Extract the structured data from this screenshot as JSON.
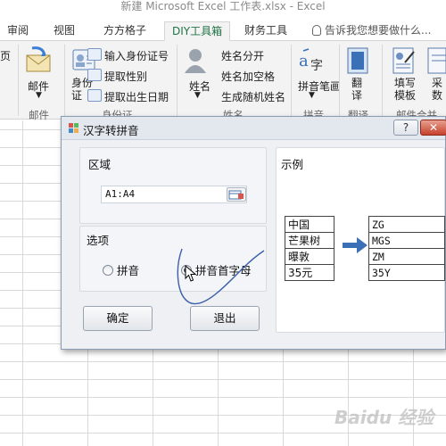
{
  "window": {
    "title": "新建 Microsoft Excel 工作表.xlsx - Excel"
  },
  "ribbon_tabs": [
    {
      "label": "审阅"
    },
    {
      "label": "视图"
    },
    {
      "label": "方方格子"
    },
    {
      "label": "DIY工具箱",
      "active": true
    },
    {
      "label": "财务工具"
    }
  ],
  "tell_me": "告诉我您想要做什么...",
  "ribbon": {
    "left_cut_label": "页",
    "mail_button": "邮件",
    "mail_group": "邮件",
    "id_button": "身份\n证",
    "id_items": [
      "输入身份证号",
      "提取性别",
      "提取出生日期"
    ],
    "id_group": "身份证",
    "name_button": "姓名",
    "name_items": [
      "姓名分开",
      "姓名加空格",
      "生成随机姓名"
    ],
    "name_group": "姓名",
    "pinyin_button": "拼音笔画",
    "pinyin_group": "拼音",
    "translate_button": "翻译",
    "translate_group": "翻译",
    "template_button": "填写模板",
    "template_group": "邮件合并",
    "collect_button": "采数"
  },
  "dialog": {
    "title": "汉字转拼音",
    "help_label": "?",
    "close_label": "✕",
    "range_label": "区域",
    "range_value": "A1:A4",
    "options_label": "选项",
    "option_pinyin": "拼音",
    "option_initials": "拼音首字母",
    "selected_option": "拼音首字母",
    "ok_button": "确定",
    "exit_button": "退出",
    "example_label": "示例",
    "example_input": [
      "中国",
      "芒果树",
      "曝敦",
      "35元"
    ],
    "example_output": [
      "ZG",
      "MGS",
      "ZM",
      "35Y"
    ]
  },
  "colors": {
    "excel_green": "#217346",
    "arrow_blue": "#3b6fb6",
    "close_red": "#c6422c"
  },
  "watermark": "Baidu 经验"
}
